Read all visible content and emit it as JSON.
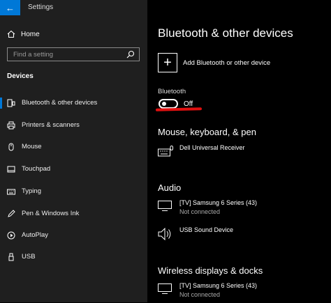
{
  "window": {
    "title": "Settings"
  },
  "sidebar": {
    "home_label": "Home",
    "search_placeholder": "Find a setting",
    "section_title": "Devices",
    "items": [
      {
        "label": "Bluetooth & other devices",
        "icon": "bluetooth-devices-icon",
        "active": true
      },
      {
        "label": "Printers & scanners",
        "icon": "printer-icon"
      },
      {
        "label": "Mouse",
        "icon": "mouse-icon"
      },
      {
        "label": "Touchpad",
        "icon": "touchpad-icon"
      },
      {
        "label": "Typing",
        "icon": "keyboard-icon"
      },
      {
        "label": "Pen & Windows Ink",
        "icon": "pen-icon"
      },
      {
        "label": "AutoPlay",
        "icon": "autoplay-icon"
      },
      {
        "label": "USB",
        "icon": "usb-icon"
      }
    ]
  },
  "main": {
    "title": "Bluetooth & other devices",
    "add_device_label": "Add Bluetooth or other device",
    "bluetooth_label": "Bluetooth",
    "bluetooth_state": "Off",
    "groups": [
      {
        "title": "Mouse, keyboard, & pen",
        "devices": [
          {
            "name": "Dell Universal Receiver",
            "status": "",
            "icon": "keyboard-mouse-icon"
          }
        ]
      },
      {
        "title": "Audio",
        "devices": [
          {
            "name": "[TV] Samsung 6 Series (43)",
            "status": "Not connected",
            "icon": "monitor-icon"
          },
          {
            "name": "USB Sound Device",
            "status": "",
            "icon": "speaker-icon"
          }
        ]
      },
      {
        "title": "Wireless displays & docks",
        "devices": [
          {
            "name": "[TV] Samsung 6 Series (43)",
            "status": "Not connected",
            "icon": "monitor-icon"
          }
        ]
      }
    ]
  },
  "colors": {
    "accent": "#0078d7",
    "annotation": "#e01010",
    "sidebar_bg": "#1f1f1f",
    "main_bg": "#000000"
  }
}
